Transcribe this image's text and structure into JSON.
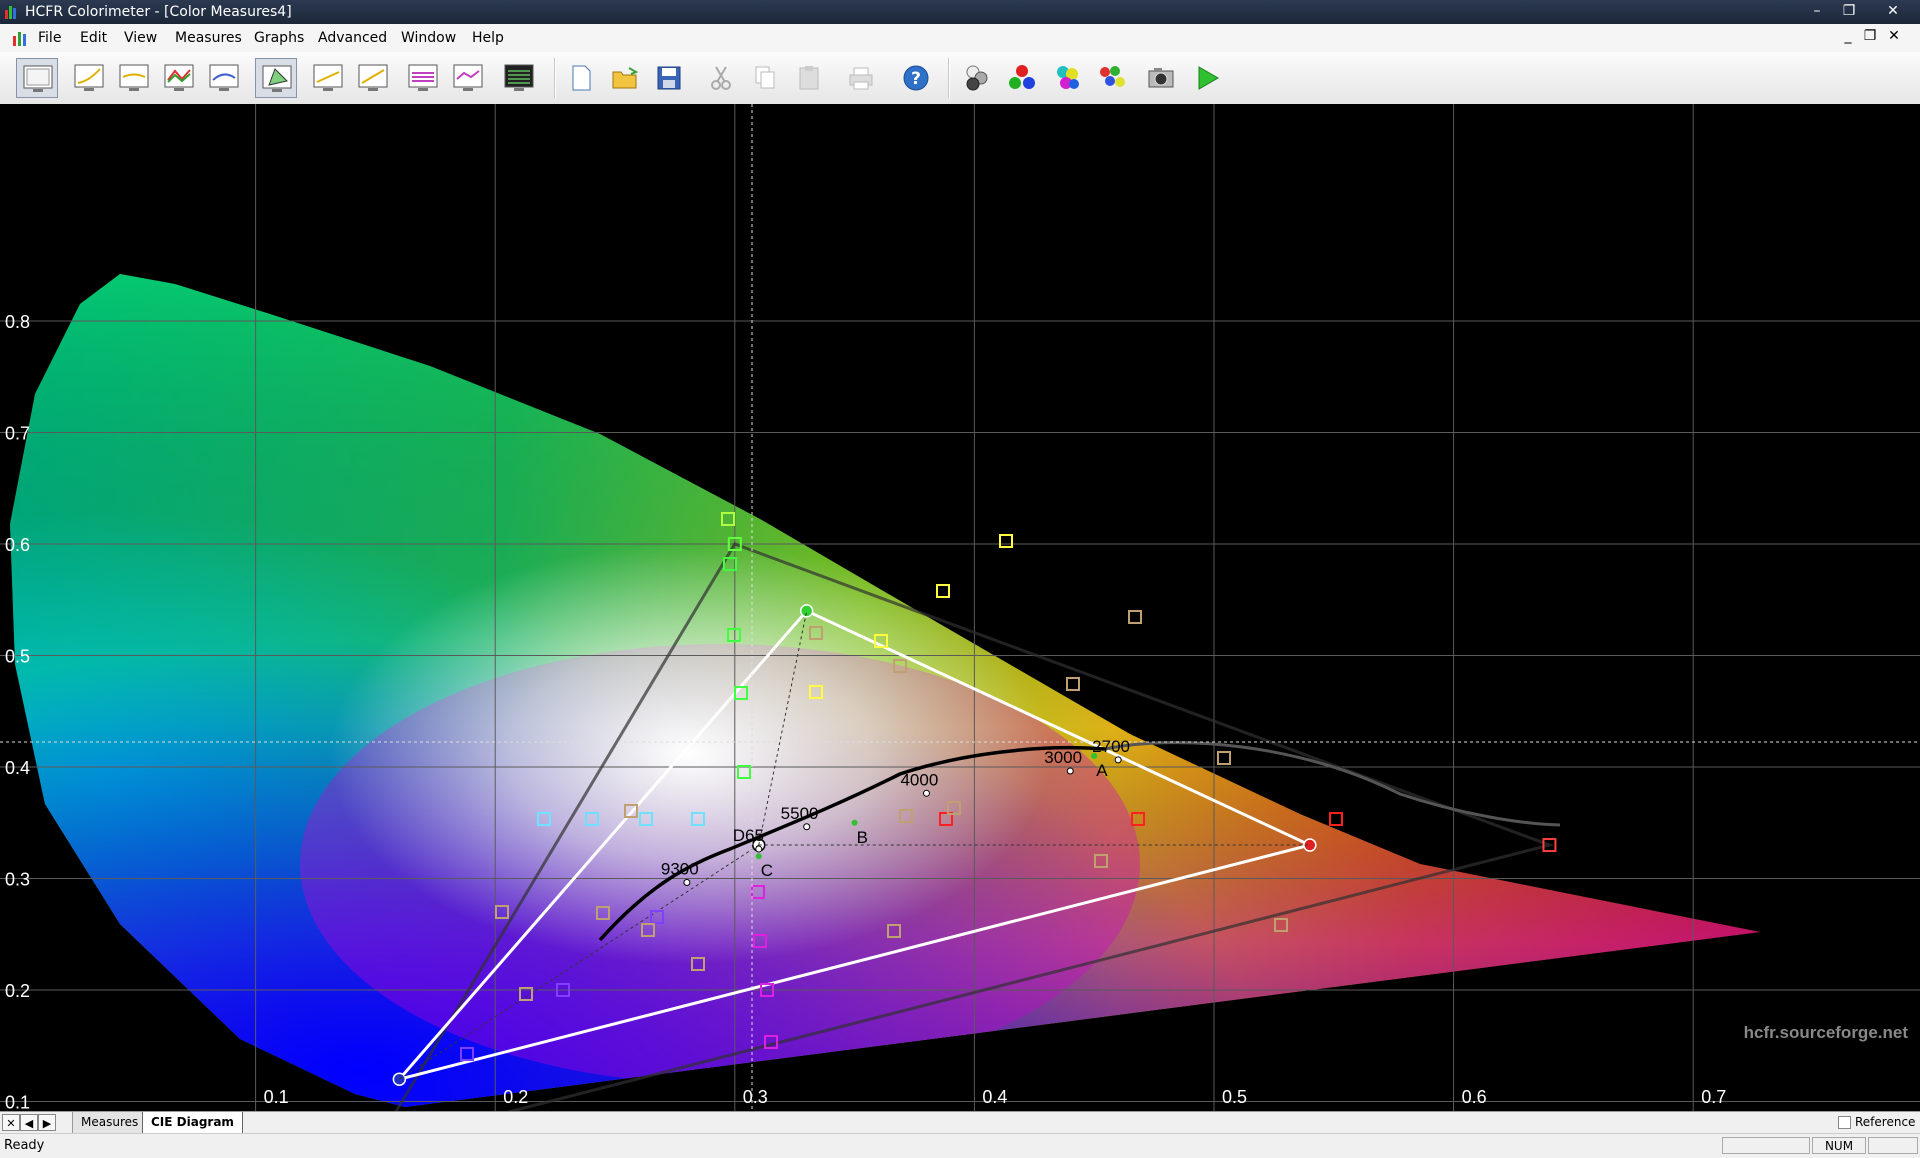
{
  "window": {
    "title": "HCFR Colorimeter - [Color Measures4]"
  },
  "menu": {
    "items": [
      "File",
      "Edit",
      "View",
      "Measures",
      "Graphs",
      "Advanced",
      "Window",
      "Help"
    ]
  },
  "tabs": {
    "items": [
      "Measures",
      "CIE Diagram"
    ],
    "active": "CIE Diagram"
  },
  "status": {
    "ready": "Ready",
    "num": "NUM",
    "reference_label": "Reference",
    "reference_checked": false
  },
  "watermark": "hcfr.sourceforge.net",
  "chart_data": {
    "type": "scatter",
    "title": "",
    "xlabel": "",
    "ylabel": "",
    "xlim": [
      0.0,
      0.8
    ],
    "ylim": [
      0.0,
      0.9
    ],
    "x_ticks": [
      "0.1",
      "0.2",
      "0.3",
      "0.4",
      "0.5",
      "0.6",
      "0.7"
    ],
    "y_ticks": [
      "0.1",
      "0.2",
      "0.3",
      "0.4",
      "0.5",
      "0.6",
      "0.7",
      "0.8"
    ],
    "grid": true,
    "reference_gamut": {
      "red": [
        0.64,
        0.33
      ],
      "green": [
        0.3,
        0.6
      ],
      "blue": [
        0.15,
        0.06
      ]
    },
    "measured_gamut": {
      "red": [
        0.54,
        0.33
      ],
      "green": [
        0.33,
        0.54
      ],
      "blue": [
        0.16,
        0.12
      ],
      "white": [
        0.31,
        0.33
      ]
    },
    "planckian_labels": [
      {
        "label": "2700",
        "x": 0.46,
        "y": 0.41
      },
      {
        "label": "3000",
        "x": 0.44,
        "y": 0.4
      },
      {
        "label": "4000",
        "x": 0.38,
        "y": 0.38
      },
      {
        "label": "5500",
        "x": 0.33,
        "y": 0.35
      },
      {
        "label": "D65",
        "x": 0.31,
        "y": 0.33
      },
      {
        "label": "9300",
        "x": 0.28,
        "y": 0.3
      }
    ],
    "illuminant_labels": [
      {
        "label": "A",
        "x": 0.45,
        "y": 0.41
      },
      {
        "label": "B",
        "x": 0.35,
        "y": 0.35
      },
      {
        "label": "C",
        "x": 0.31,
        "y": 0.32
      }
    ]
  }
}
